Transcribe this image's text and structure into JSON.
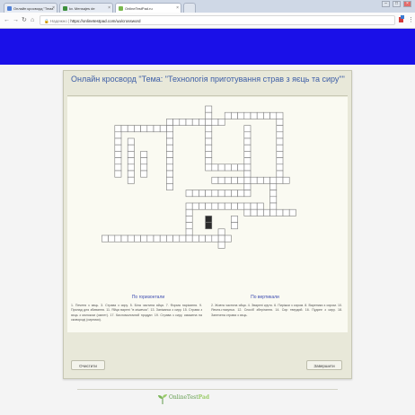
{
  "browser": {
    "tabs": [
      {
        "label": "Онлайн кросворд \"Тема",
        "active": false
      },
      {
        "label": "kv. Mensajes de",
        "active": false
      },
      {
        "label": "OnlineTestPad.ru",
        "active": true
      }
    ],
    "url_prefix": "Надежно",
    "url": "https://onlinetestpad.com/ua/crossword",
    "icons": [
      "back-icon",
      "forward-icon",
      "reload-icon",
      "home-icon",
      "star-icon",
      "menu-icon"
    ]
  },
  "card": {
    "title": "Онлайн кросворд \"Тема: \"Технологія приготування страв з яєць та сиру\"\""
  },
  "puzzle": {
    "cell_color": "#ffffff",
    "border_color": "#7a7a7a",
    "filled_color": "#2b2b2b",
    "across_heading": "По горизонтали",
    "down_heading": "По вертикали",
    "across_clues": "1. Печеня з яєць. 3. Страва з сиру. 5. Біла частина яйця. 7. Форма нарізання. 9. Прилад для збивання. 11. Яйця варені \"в мішечок\". 13. Запіканка з сиру. 15. Страва з яєць з молоком (омлет). 17. Кисломолочний продукт. 19. Страва з сиру, смажена на сковороді (сирники).",
    "down_clues": "2. Жовта частина яйця. 4. Зварені круто. 6. Пиріжки з сиром. 8. Вареники з сиром. 10. Яєчня-глазунья. 12. Спосіб зберігання. 14. Сир твердий. 16. Пудинг з сиру. 18. Запечена страва з яєць.",
    "clear_label": "Очистити",
    "finish_label": "Завершити"
  },
  "footer": {
    "logo_text": "OnlineTest",
    "logo_tld": "Pad"
  }
}
